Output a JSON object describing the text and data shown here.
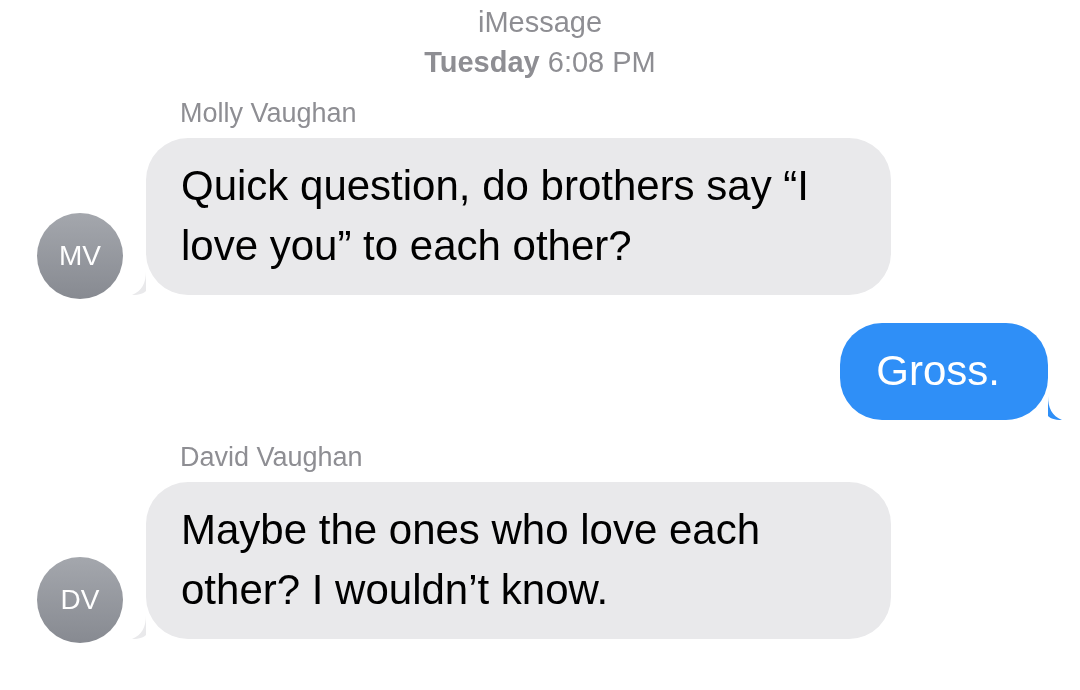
{
  "header": {
    "service": "iMessage",
    "timestamp": "**Tuesday** 6:08 PM"
  },
  "messages": [
    {
      "kind": "received",
      "sender": "Molly Vaughan",
      "initials": "MV",
      "text": "Quick question, do brothers say “I love you” to each other?"
    },
    {
      "kind": "sent",
      "text": "Gross."
    },
    {
      "kind": "received",
      "sender": "David Vaughan",
      "initials": "DV",
      "text": "Maybe the ones who love each other? I wouldn’t know."
    }
  ]
}
